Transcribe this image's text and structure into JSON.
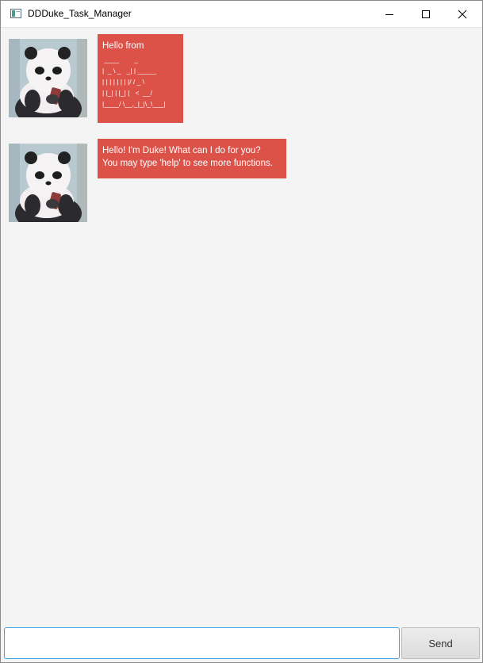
{
  "window": {
    "title": "DDDuke_Task_Manager",
    "controls": {
      "minimize": "minimize-icon",
      "maximize": "maximize-icon",
      "close": "close-icon"
    }
  },
  "messages": [
    {
      "sender": "duke",
      "avatar": "panda-avatar",
      "lines": [
        "Hello from"
      ],
      "ascii": [
        " ____        _        ",
        "|  _ \\ _   _| | _____ ",
        "| | | | | | | |/ / _ \\",
        "| |_| | |_| |   <  __/",
        "|____/ \\__,_|_|\\_\\___|"
      ]
    },
    {
      "sender": "duke",
      "avatar": "panda-avatar",
      "lines": [
        "Hello! I'm Duke! What can I do for you?",
        "You may type 'help' to see more functions."
      ]
    }
  ],
  "input": {
    "value": "",
    "placeholder": ""
  },
  "send_label": "Send",
  "colors": {
    "bubble": "#dc5148",
    "background": "#f4f4f4",
    "input_border": "#3aa3e3"
  }
}
